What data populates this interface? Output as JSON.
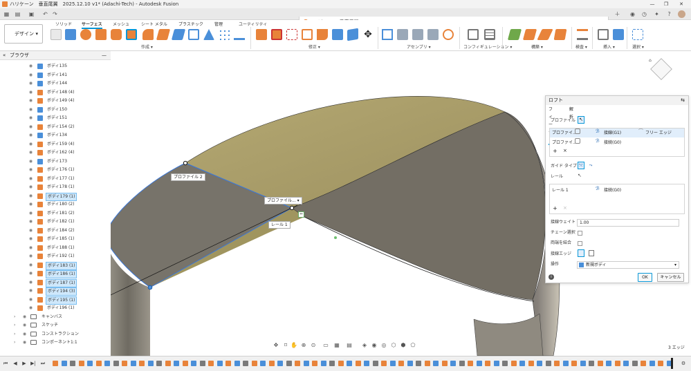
{
  "window": {
    "title": "ハリケーン　垂直尾翼　2025.12.10 v1* (Adachi-Tech) - Autodesk Fusion",
    "controls": [
      "—",
      "❐",
      "✕"
    ]
  },
  "document_tab": {
    "title": "ハリケーン　垂直尾翼　2025.12.10 v1*",
    "close": "✕"
  },
  "ribbon": {
    "workspace": "デザイン",
    "tabs": [
      "ソリッド",
      "サーフェス",
      "メッシュ",
      "シート メタル",
      "プラスチック",
      "管理",
      "ユーティリティ"
    ],
    "active_tab": "サーフェス",
    "groups": [
      "作成 ▾",
      "修正 ▾",
      "アセンブリ ▾",
      "コンフィギュレーション ▾",
      "構築 ▾",
      "検査 ▾",
      "挿入 ▾",
      "選択 ▾"
    ]
  },
  "browser": {
    "title": "ブラウザ",
    "bodies": [
      {
        "label": "ボディ135",
        "color": "blue"
      },
      {
        "label": "ボディ141",
        "color": "blue"
      },
      {
        "label": "ボディ144",
        "color": "blue"
      },
      {
        "label": "ボディ148 (4)",
        "color": "orange"
      },
      {
        "label": "ボディ149 (4)",
        "color": "orange"
      },
      {
        "label": "ボディ150",
        "color": "blue"
      },
      {
        "label": "ボディ151",
        "color": "blue"
      },
      {
        "label": "ボディ154 (2)",
        "color": "orange"
      },
      {
        "label": "ボディ134",
        "color": "blue"
      },
      {
        "label": "ボディ159 (4)",
        "color": "orange"
      },
      {
        "label": "ボディ162 (4)",
        "color": "orange"
      },
      {
        "label": "ボディ173",
        "color": "blue"
      },
      {
        "label": "ボディ176 (1)",
        "color": "orange"
      },
      {
        "label": "ボディ177 (1)",
        "color": "orange"
      },
      {
        "label": "ボディ178 (1)",
        "color": "orange"
      },
      {
        "label": "ボディ179 (1)",
        "color": "orange",
        "selected": true
      },
      {
        "label": "ボディ180 (2)",
        "color": "orange"
      },
      {
        "label": "ボディ181 (2)",
        "color": "orange"
      },
      {
        "label": "ボディ182 (1)",
        "color": "orange"
      },
      {
        "label": "ボディ184 (2)",
        "color": "orange"
      },
      {
        "label": "ボディ185 (1)",
        "color": "orange"
      },
      {
        "label": "ボディ188 (1)",
        "color": "orange"
      },
      {
        "label": "ボディ192 (1)",
        "color": "orange"
      },
      {
        "label": "ボディ183 (1)",
        "color": "orange",
        "selected": true
      },
      {
        "label": "ボディ186 (1)",
        "color": "orange",
        "selected": true
      },
      {
        "label": "ボディ187 (1)",
        "color": "orange",
        "selected": true
      },
      {
        "label": "ボディ194 (3)",
        "color": "orange",
        "selected": true
      },
      {
        "label": "ボディ195 (1)",
        "color": "orange",
        "selected": true
      },
      {
        "label": "ボディ196 (1)",
        "color": "orange"
      }
    ],
    "folders": [
      "キャンバス",
      "スケッチ",
      "コンストラクション",
      "コンポーネント1:1"
    ]
  },
  "viewport_labels": {
    "profile2": "プロファイル 2",
    "profile1": "プロファイル... ▾",
    "rail1": "レール 1"
  },
  "loft_panel": {
    "title": "ロフト",
    "tabs": [
      "フィーチャ",
      "解析"
    ],
    "profile_label": "プロファイル",
    "profiles": [
      {
        "name": "プロファイ...",
        "cond": "接線(G1)",
        "extra": "フリー エッジ"
      },
      {
        "name": "プロファイ...",
        "cond": "接続(G0)",
        "extra": ""
      }
    ],
    "guide_type_label": "ガイド タイプ",
    "rail_label": "レール",
    "rails": [
      {
        "name": "レール 1",
        "cond": "接続(G0)"
      }
    ],
    "tangent_weight_label": "接線ウェイト",
    "tangent_weight_value": "1.00",
    "chain_label": "チェーン選択",
    "merge_label": "両端を結合",
    "tangent_edge_label": "接線エッジ",
    "operation_label": "操作",
    "operation_value": "新規ボディ",
    "ok": "OK",
    "cancel": "キャンセル"
  },
  "status": {
    "edges": "3 エッジ"
  },
  "colors": {
    "accent": "#0696d7",
    "orange": "#e8833a",
    "blue": "#4a8fd9",
    "top_face": "#a89c6a",
    "side_face": "#8a857a"
  }
}
